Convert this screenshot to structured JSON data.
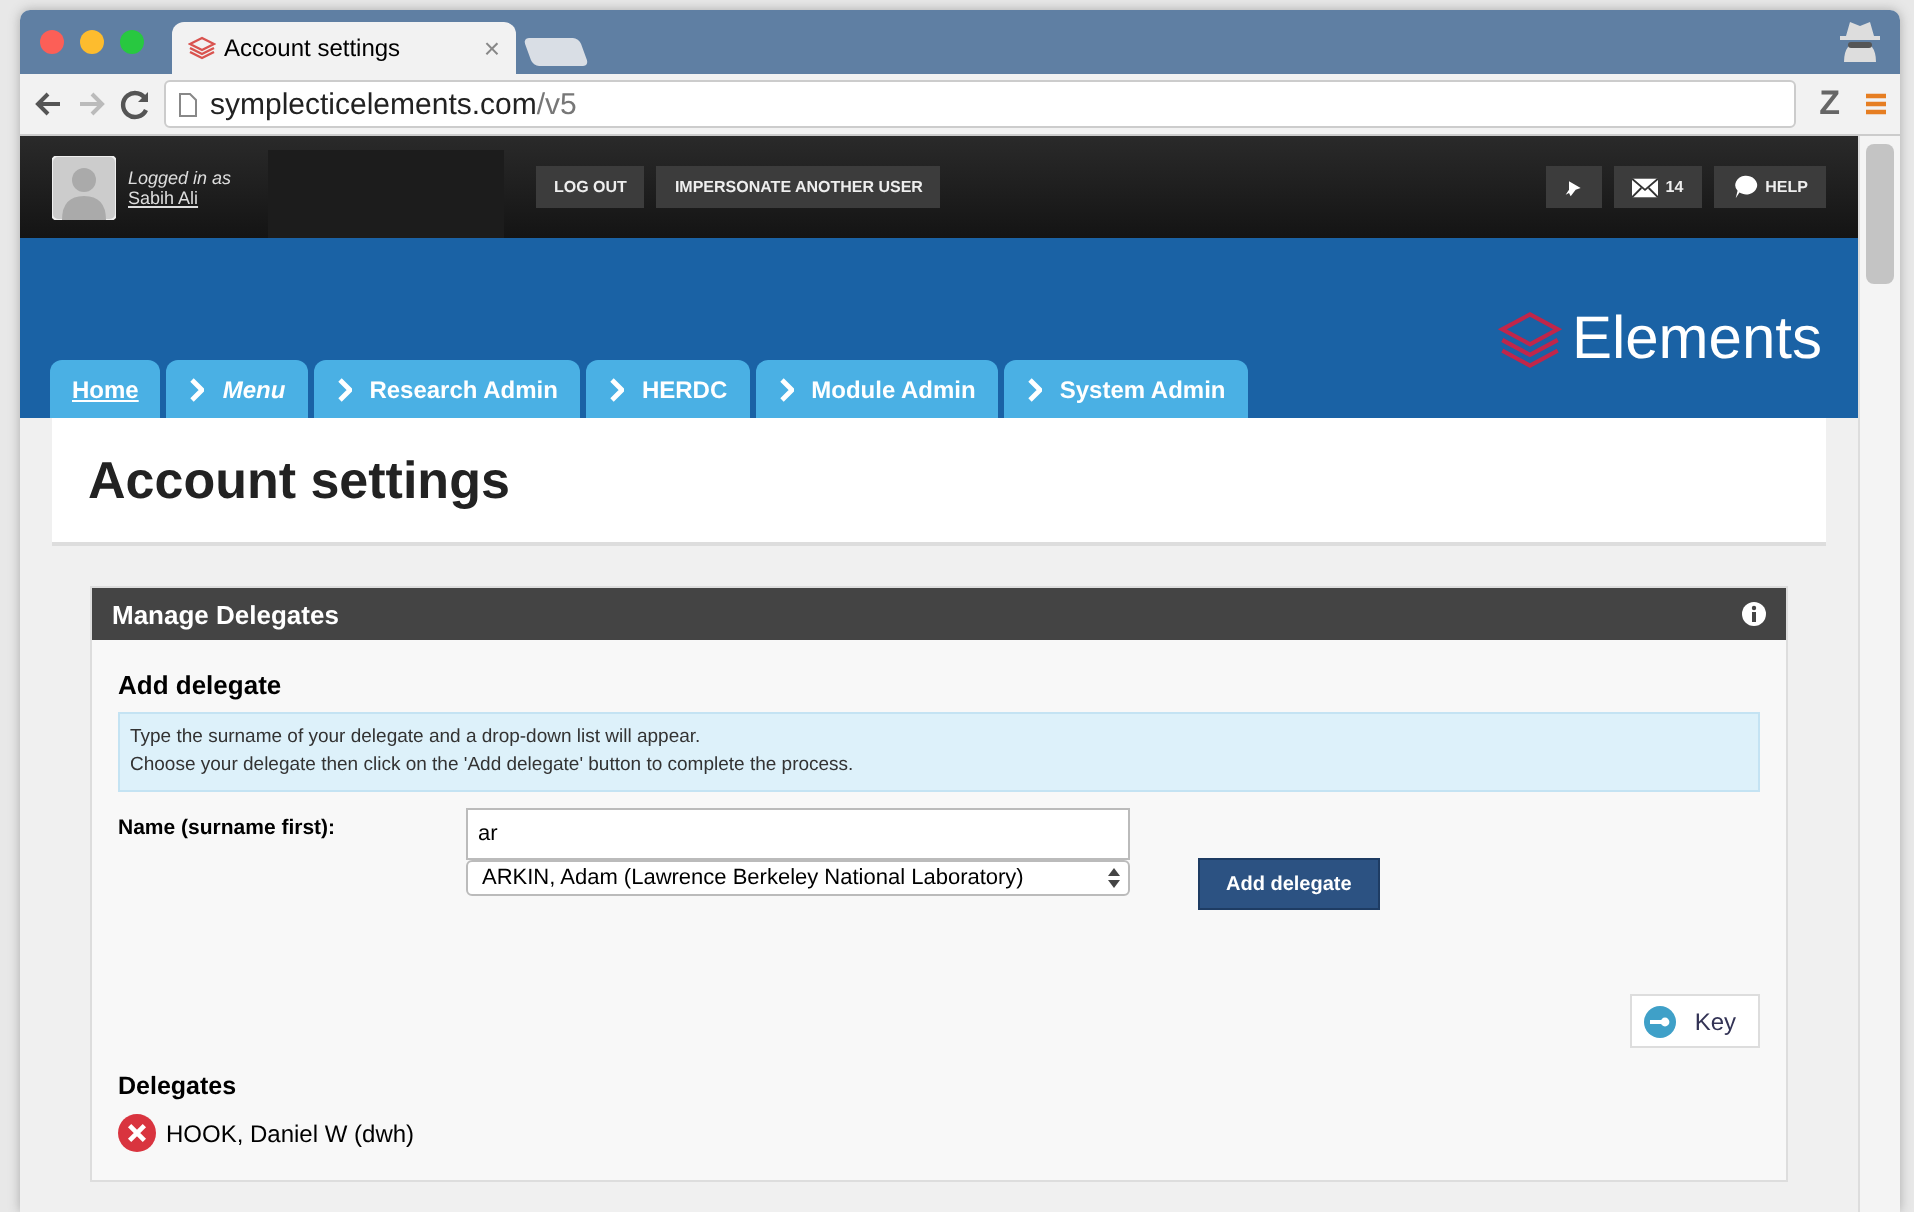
{
  "browser": {
    "tab_title": "Account settings",
    "tab_close": "×",
    "url_host": "symplecticelements.com",
    "url_path": "/v5",
    "ext_label": "Z"
  },
  "header": {
    "logged_in_label": "Logged in as",
    "user_name": "Sabih Ali",
    "buttons": [
      "LOG OUT",
      "IMPERSONATE ANOTHER USER"
    ],
    "message_count": "14",
    "help": "HELP"
  },
  "logo": "Elements",
  "nav_tabs": [
    {
      "label": "Home",
      "kind": "home"
    },
    {
      "label": "Menu",
      "kind": "menu"
    },
    {
      "label": "Research Admin",
      "kind": "section"
    },
    {
      "label": "HERDC",
      "kind": "section"
    },
    {
      "label": "Module Admin",
      "kind": "section"
    },
    {
      "label": "System Admin",
      "kind": "section"
    }
  ],
  "page_title": "Account settings",
  "panel": {
    "title": "Manage Delegates",
    "section_title": "Add delegate",
    "info_lines": [
      "Type the surname of your delegate and a drop-down list will appear.",
      "Choose your delegate then click on the 'Add delegate' button to complete the process."
    ],
    "name_label": "Name (surname first):",
    "name_value": "ar",
    "select_value": "ARKIN, Adam (Lawrence Berkeley National Laboratory)",
    "add_button": "Add delegate",
    "key_button": "Key",
    "delegates_title": "Delegates",
    "delegates": [
      "HOOK, Daniel W (dwh)"
    ]
  }
}
